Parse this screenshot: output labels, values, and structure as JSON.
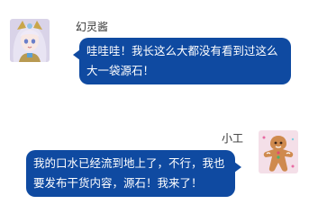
{
  "messages": [
    {
      "side": "left",
      "sender": "幻灵酱",
      "avatar_icon": "anime-girl-avatar-icon",
      "text": "哇哇哇！我长这么大都没有看到过这么大一袋源石！"
    },
    {
      "side": "right",
      "sender": "小工",
      "avatar_icon": "gingerbread-man-avatar-icon",
      "text": "我的口水已经流到地上了，不行，我也要发布干货内容，源石！我来了！"
    }
  ],
  "colors": {
    "bubble": "#0f4aa1",
    "bubble_text": "#ffffff",
    "name_text": "#333333",
    "background": "#ffffff"
  }
}
